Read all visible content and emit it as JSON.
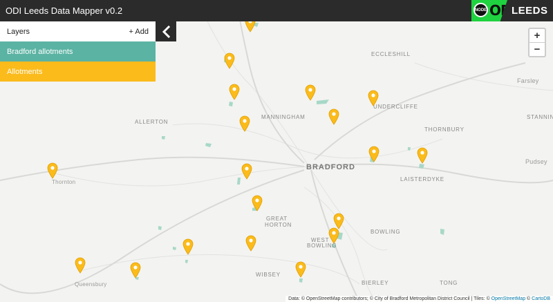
{
  "header": {
    "title": "ODI Leeds Data Mapper v0.2",
    "logo_node": "NODE",
    "logo_odi": "ODI",
    "logo_city": "LEEDS"
  },
  "layers_panel": {
    "title": "Layers",
    "add_label": "+ Add",
    "layers": [
      {
        "name": "Bradford allotments",
        "color": "#5bb3a3"
      },
      {
        "name": "Allotments",
        "color": "#fbbb1b"
      }
    ],
    "collapse_icon": "chevron-left-icon"
  },
  "zoom": {
    "in": "+",
    "out": "−"
  },
  "map_labels": [
    {
      "name": "ECCLESHILL"
    },
    {
      "name": "UNDERCLIFFE"
    },
    {
      "name": "Farsley"
    },
    {
      "name": "MANNINGHAM"
    },
    {
      "name": "ALLERTON"
    },
    {
      "name": "THORNBURY"
    },
    {
      "name": "STANNINGLE"
    },
    {
      "name": "BRADFORD"
    },
    {
      "name": "Pudsey"
    },
    {
      "name": "LAISTERDYKE"
    },
    {
      "name": "Thornton"
    },
    {
      "name": "GREAT"
    },
    {
      "name": "HORTON"
    },
    {
      "name": "BOWLING"
    },
    {
      "name": "WEST"
    },
    {
      "name": "BOWLING"
    },
    {
      "name": "Queensbury"
    },
    {
      "name": "WIBSEY"
    },
    {
      "name": "BIERLEY"
    },
    {
      "name": "TONG"
    }
  ],
  "marker_color": "#fbbb1b",
  "attribution": {
    "text": "Data: © OpenStreetMap contributors; © City of Bradford Metropolitan District Council | Tiles: © ",
    "osm": "OpenStreetMap",
    "sep": " © ",
    "carto": "CartoDB"
  }
}
